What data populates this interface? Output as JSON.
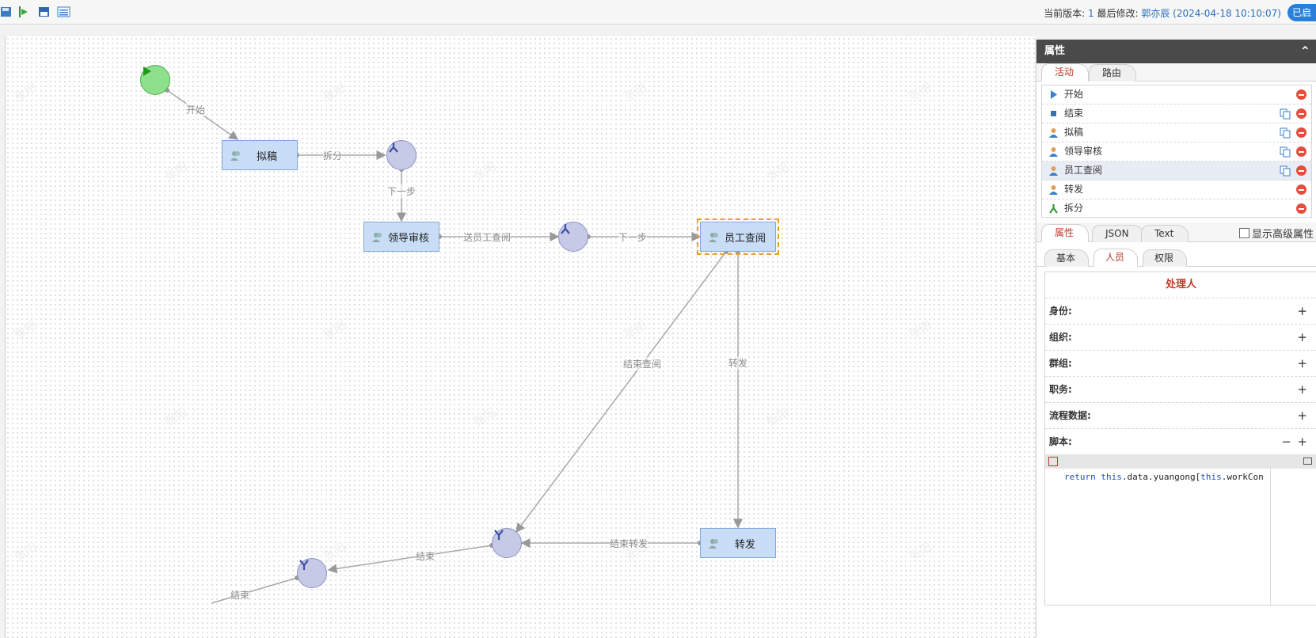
{
  "toolbar": {
    "icons": [
      "save-icon",
      "publish-flow-icon",
      "save-as-icon",
      "list-icon"
    ],
    "version_label": "当前版本:",
    "version_num": "1",
    "modified_label": "最后修改:",
    "modified_value": "郭亦辰 (2024-04-18 10:10:07)",
    "publish_label": "已启"
  },
  "canvas": {
    "nodes": {
      "draft": "拟稿",
      "leader": "领导审核",
      "employee": "员工查阅",
      "forward": "转发"
    },
    "edges": {
      "start": "开始",
      "split": "拆分",
      "next1": "下一步",
      "send_employee": "送员工查阅",
      "next2": "下一步",
      "end_review": "结束查阅",
      "forward": "转发",
      "end_forward": "结束转发",
      "end1": "结束",
      "end2": "结束"
    },
    "watermark": "张阳"
  },
  "panel": {
    "title": "属性",
    "top_tabs": [
      "活动",
      "路由"
    ],
    "activities": [
      {
        "name": "开始",
        "icon": "start-arrow-icon"
      },
      {
        "name": "结束",
        "icon": "end-square-icon"
      },
      {
        "name": "拟稿",
        "icon": "person-icon"
      },
      {
        "name": "领导审核",
        "icon": "person-icon"
      },
      {
        "name": "员工查阅",
        "icon": "person-icon"
      },
      {
        "name": "转发",
        "icon": "person-icon"
      },
      {
        "name": "拆分",
        "icon": "split-icon"
      }
    ],
    "prop_tabs": [
      "属性",
      "JSON",
      "Text"
    ],
    "advanced_label": "显示高级属性",
    "sub_tabs": [
      "基本",
      "人员",
      "权限"
    ],
    "form": {
      "header": "处理人",
      "rows": [
        "身份:",
        "组织:",
        "群组:",
        "职务:",
        "流程数据:",
        "脚本:"
      ]
    },
    "code": {
      "kw1": "return",
      "kw2": "this",
      "mid": ".data.yuangong[",
      "kw3": "this",
      "tail": ".workCon"
    }
  }
}
